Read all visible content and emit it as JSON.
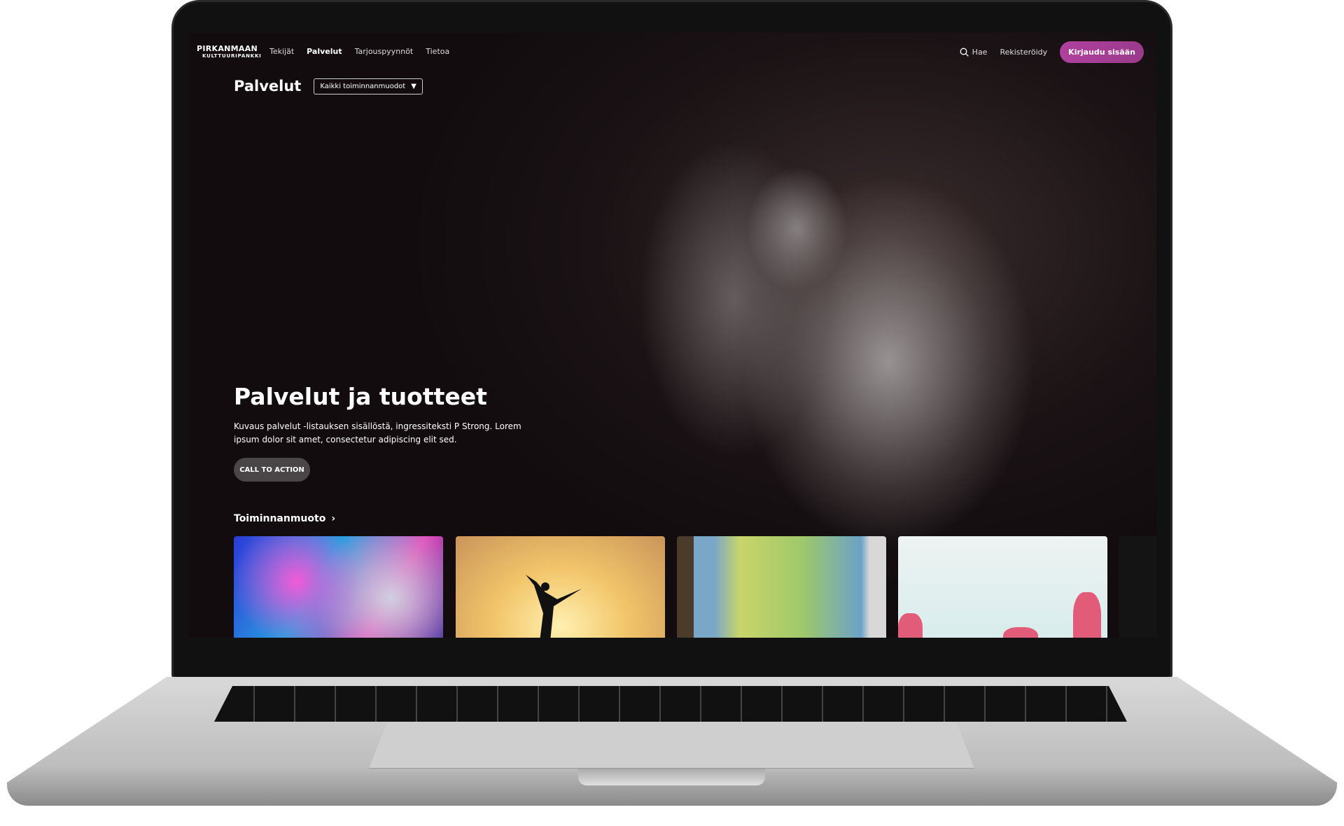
{
  "nav": {
    "logo_line1": "PIRKANMAAN",
    "logo_line2": "KULTTUURIPANKKI",
    "links": [
      {
        "label": "Tekijät"
      },
      {
        "label": "Palvelut",
        "active": true
      },
      {
        "label": "Tarjouspyynnöt"
      },
      {
        "label": "Tietoa"
      }
    ],
    "search_label": "Hae",
    "register_label": "Rekisteröidy",
    "login_label": "Kirjaudu sisään",
    "accent": "#a93e97"
  },
  "page": {
    "title": "Palvelut",
    "filter_value": "Kaikki toiminnanmuodot"
  },
  "hero": {
    "title": "Palvelut ja tuotteet",
    "description": "Kuvaus palvelut -listauksen sisällöstä, ingressiteksti P Strong. Lorem ipsum dolor sit amet, consectetur adipiscing elit sed.",
    "cta_label": "CALL TO ACTION"
  },
  "section": {
    "title": "Toiminnanmuoto",
    "chevron": "chevron-right-icon"
  }
}
